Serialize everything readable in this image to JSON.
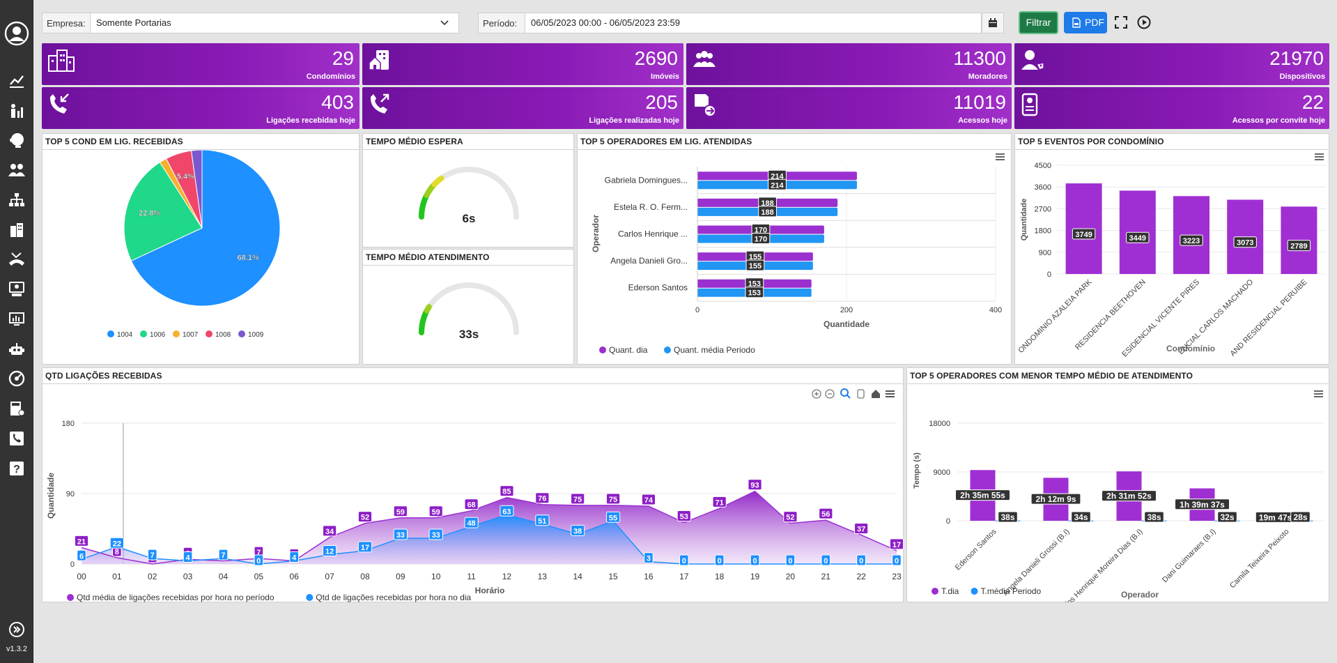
{
  "app": {
    "version": "v1.3.2"
  },
  "filters": {
    "empresa_label": "Empresa:",
    "empresa_value": "Somente Portarias",
    "periodo_label": "Período:",
    "periodo_value": "06/05/2023 00:00 - 06/05/2023 23:59",
    "filtrar": "Filtrar",
    "pdf": "PDF"
  },
  "colors": {
    "kpi": "#7a14a8",
    "purple": "#9b30d0",
    "blue": "#1e90ff",
    "green_btn": "#1e7a45",
    "pdf_btn": "#1e7be8"
  },
  "sidebar": {
    "icons": [
      "user-avatar-icon",
      "dashboard-chart-icon",
      "people-stats-icon",
      "operator-headset-icon",
      "users-group-icon",
      "org-chart-icon",
      "building-icon",
      "missed-call-icon",
      "support-desk-icon",
      "monitor-chart-icon",
      "robot-icon",
      "gauge-icon",
      "calculator-icon",
      "phone-list-icon",
      "help-icon",
      "expand-icon"
    ]
  },
  "kpis": [
    {
      "value": "29",
      "label": "Condomínios",
      "icon": "condo-buildings-icon"
    },
    {
      "value": "2690",
      "label": "Imóveis",
      "icon": "property-building-icon"
    },
    {
      "value": "11300",
      "label": "Moradores",
      "icon": "residents-group-icon"
    },
    {
      "value": "21970",
      "label": "Dispositivos",
      "icon": "user-device-icon"
    },
    {
      "value": "403",
      "label": "Ligações recebidas hoje",
      "icon": "incoming-call-icon"
    },
    {
      "value": "205",
      "label": "Ligações realizadas hoje",
      "icon": "outgoing-call-icon"
    },
    {
      "value": "11019",
      "label": "Acessos hoje",
      "icon": "access-door-icon"
    },
    {
      "value": "22",
      "label": "Acessos por convite hoje",
      "icon": "invite-badge-icon"
    }
  ],
  "cards": {
    "pie": "TOP 5 COND EM LIG. RECEBIDAS",
    "espera": "TEMPO MÉDIO ESPERA",
    "atendimento": "TEMPO MÉDIO ATENDIMENTO",
    "operadores": "TOP 5 OPERADORES EM LIG. ATENDIDAS",
    "eventos": "TOP 5 EVENTOS POR CONDOMÍNIO",
    "ligacoes": "QTD LIGAÇÕES RECEBIDAS",
    "menor_tempo": "TOP 5 OPERADORES COM MENOR TEMPO MÉDIO DE ATENDIMENTO"
  },
  "gauges": {
    "espera": {
      "value": "6s",
      "fraction": 0.3
    },
    "atendimento": {
      "value": "33s",
      "fraction": 0.18
    }
  },
  "chart_data": [
    {
      "type": "pie",
      "title": "TOP 5 COND EM LIG. RECEBIDAS",
      "slices": [
        {
          "name": "1004",
          "value": 68.1,
          "color": "#1e90ff"
        },
        {
          "name": "1006",
          "value": 22.8,
          "color": "#1fd88a"
        },
        {
          "name": "1007",
          "value": 1.5,
          "color": "#f6b02b"
        },
        {
          "name": "1008",
          "value": 5.4,
          "color": "#f0466a"
        },
        {
          "name": "1009",
          "value": 2.2,
          "color": "#7a59d0"
        }
      ],
      "labels_shown": [
        "68.1%",
        "22.8%",
        "5.4%"
      ]
    },
    {
      "type": "bar",
      "title": "TOP 5 OPERADORES EM LIG. ATENDIDAS",
      "orientation": "horizontal",
      "ylabel": "Operador",
      "xlabel": "Quantidade",
      "xlim": [
        0,
        400
      ],
      "xticks": [
        "0",
        "200",
        "400"
      ],
      "categories": [
        "Gabriela Domingues...",
        "Estela R. O. Ferm...",
        "Carlos Henrique ...",
        "Angela Danieli Gro...",
        "Ederson Santos"
      ],
      "series": [
        {
          "name": "Quant. dia",
          "color": "#9b30d0",
          "values": [
            214,
            188,
            170,
            155,
            153
          ]
        },
        {
          "name": "Quant. média Periodo",
          "color": "#2196f3",
          "values": [
            214,
            188,
            170,
            155,
            153
          ]
        }
      ]
    },
    {
      "type": "bar",
      "title": "TOP 5 EVENTOS POR CONDOMÍNIO",
      "xlabel": "Condomínio",
      "ylabel": "Quantidade",
      "ylim": [
        0,
        4500
      ],
      "yticks": [
        "0",
        "900",
        "1800",
        "2700",
        "3600",
        "4500"
      ],
      "categories": [
        "CONDOMINIO AZALEIA PARK",
        "RESIDENCIA BEETHOVEN",
        "RESIDENCIAL VICENTE PIRES",
        "RESIDENCIAL CARLOS MACHADO",
        "GRAND RESIDENCIAL PERUIBE"
      ],
      "categories_display": [
        "ONDOMINIO AZALEIA PARK",
        "RESIDENCIA BEETHOVEN",
        "ESIDENCIAL VICENTE PIRES",
        "ENCIAL CARLOS MACHADO",
        "AND RESIDENCIAL PERUIBE"
      ],
      "values": [
        3749,
        3449,
        3223,
        3073,
        2789
      ]
    },
    {
      "type": "area",
      "title": "QTD LIGAÇÕES RECEBIDAS",
      "xlabel": "Horário",
      "ylabel": "Quantidade",
      "ylim": [
        0,
        180
      ],
      "yticks": [
        "0",
        "90",
        "180"
      ],
      "x": [
        "00",
        "01",
        "02",
        "03",
        "04",
        "05",
        "06",
        "07",
        "08",
        "09",
        "10",
        "11",
        "12",
        "13",
        "14",
        "15",
        "16",
        "17",
        "18",
        "19",
        "20",
        "21",
        "22",
        "23"
      ],
      "series": [
        {
          "name": "Qtd média de ligações recebidas por hora no período",
          "color": "#9b30d0",
          "values": [
            21,
            8,
            0,
            6,
            4,
            7,
            4,
            34,
            52,
            59,
            59,
            68,
            85,
            76,
            75,
            75,
            74,
            53,
            71,
            93,
            52,
            56,
            37,
            17
          ]
        },
        {
          "name": "Qtd de ligações recebidas por hora no dia",
          "color": "#1e90ff",
          "values": [
            6,
            22,
            7,
            4,
            7,
            0,
            4,
            12,
            17,
            33,
            33,
            48,
            63,
            51,
            38,
            55,
            3,
            0,
            0,
            0,
            0,
            0,
            0,
            0
          ]
        }
      ]
    },
    {
      "type": "bar",
      "title": "TOP 5 OPERADORES COM MENOR TEMPO MÉDIO DE ATENDIMENTO",
      "xlabel": "Operador",
      "ylabel": "Tempo (s)",
      "ylim": [
        0,
        18000
      ],
      "yticks": [
        "0",
        "9000",
        "18000"
      ],
      "categories": [
        "Ederson Santos",
        "Angela Danieli Grossi (B.I)",
        "Carlos Henrique Moreira Dias (B.I)",
        "Dani Guimaraes (B.I)",
        "Camila Teixeira Peixoto"
      ],
      "series": [
        {
          "name": "T.dia",
          "color": "#9b30d0",
          "values": [
            9355,
            7929,
            9112,
            5977,
            1187
          ],
          "labels": [
            "2h 35m 55s",
            "2h 12m 9s",
            "2h 31m 52s",
            "1h 39m 37s",
            "19m 47s"
          ]
        },
        {
          "name": "T.média Periodo",
          "color": "#1e90ff",
          "values": [
            38,
            34,
            38,
            32,
            28
          ],
          "labels": [
            "38s",
            "34s",
            "38s",
            "32s",
            "28s"
          ]
        }
      ]
    }
  ]
}
